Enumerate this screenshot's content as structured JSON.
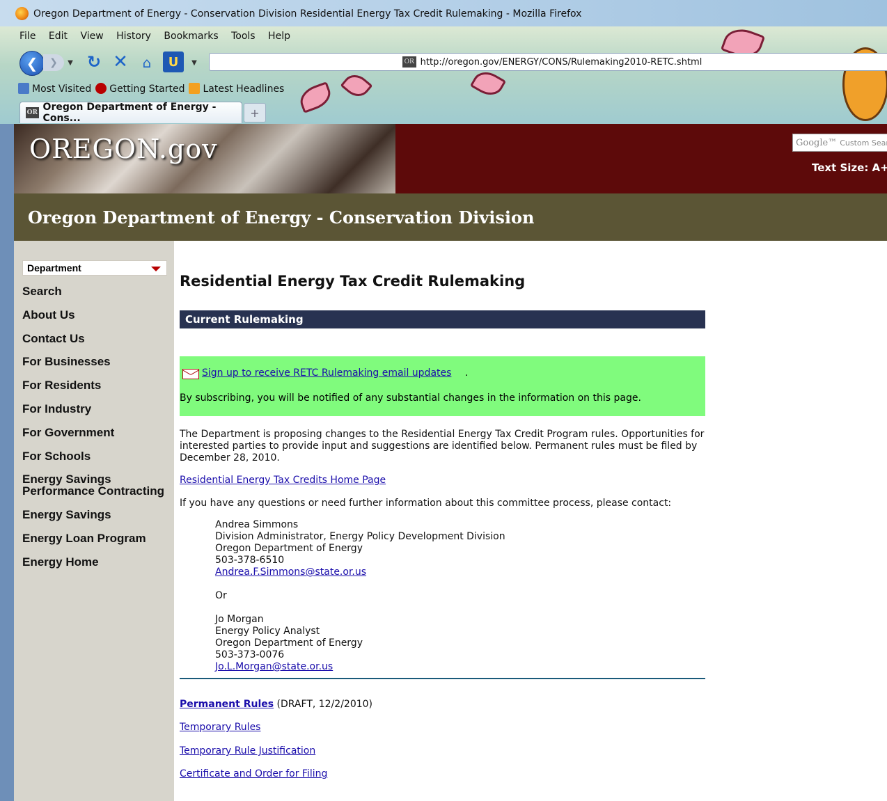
{
  "window": {
    "title": "Oregon Department of Energy - Conservation Division Residential Energy Tax Credit Rulemaking - Mozilla Firefox"
  },
  "menu": [
    "File",
    "Edit",
    "View",
    "History",
    "Bookmarks",
    "Tools",
    "Help"
  ],
  "address": {
    "favicon": "OR",
    "url": "http://oregon.gov/ENERGY/CONS/Rulemaking2010-RETC.shtml"
  },
  "bookmarks": [
    "Most Visited",
    "Getting Started",
    "Latest Headlines"
  ],
  "tab": {
    "favicon": "OR",
    "label": "Oregon Department of Energy - Cons...",
    "new_tab": "+"
  },
  "banner": {
    "logo": "OREGON.gov",
    "search_brand": "Google™",
    "search_placeholder": "Custom Sear",
    "text_size": "Text Size: A+"
  },
  "division_title": "Oregon Department of Energy - Conservation Division",
  "sidebar": {
    "select_value": "Department",
    "items": [
      "Search",
      "About Us",
      "Contact Us",
      "For Businesses",
      "For Residents",
      "For Industry",
      "For Government",
      "For Schools",
      "Energy Savings Performance Contracting",
      "Energy Savings",
      "Energy Loan Program",
      "Energy Home"
    ]
  },
  "main": {
    "title": "Residential Energy Tax Credit Rulemaking",
    "section_heading": "Current Rulemaking",
    "signup_link": "Sign up to receive RETC Rulemaking email updates",
    "signup_period": ".",
    "notice_text": "By subscribing, you will be notified of any substantial changes in the information on this page.",
    "intro": "The Department is proposing changes to the Residential Energy Tax Credit Program rules. Opportunities for interested parties to provide input and suggestions are identified below. Permanent rules must be filed by December 28, 2010.",
    "home_link": "Residential Energy Tax Credits Home Page",
    "questions": "If you have any questions or need further information about this committee process, please contact:",
    "contact1": {
      "name": "Andrea Simmons",
      "title": "Division Administrator, Energy Policy Development Division",
      "org": "Oregon Department of Energy",
      "phone": "503-378-6510",
      "email": "Andrea.F.Simmons@state.or.us"
    },
    "or": "Or",
    "contact2": {
      "name": "Jo Morgan",
      "title": "Energy Policy Analyst",
      "org": "Oregon Department of Energy",
      "phone": "503-373-0076",
      "email": "Jo.L.Morgan@state.or.us"
    },
    "permanent_link": "Permanent Rules",
    "permanent_note": " (DRAFT, 12/2/2010)",
    "temp_rules": "Temporary Rules",
    "temp_justification": "Temporary Rule Justification",
    "certificate": "Certificate and Order for Filing"
  }
}
